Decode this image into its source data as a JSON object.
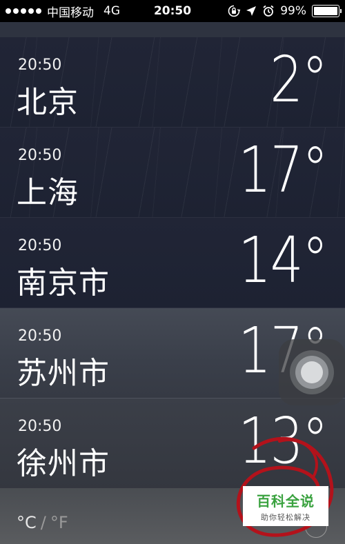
{
  "status": {
    "carrier": "中国移动",
    "network": "4G",
    "time": "20:50",
    "battery": "99%",
    "battery_level": 0.99
  },
  "cities": [
    {
      "time": "20:50",
      "name": "北京",
      "temp": "2°"
    },
    {
      "time": "20:50",
      "name": "上海",
      "temp": "17°"
    },
    {
      "time": "20:50",
      "name": "南京市",
      "temp": "14°"
    },
    {
      "time": "20:50",
      "name": "苏州市",
      "temp": "17°"
    },
    {
      "time": "20:50",
      "name": "徐州市",
      "temp": "13°"
    }
  ],
  "units": {
    "celsius": "°C",
    "separator": "/",
    "fahrenheit": "°F"
  },
  "watermark": {
    "title": "百科全说",
    "subtitle": "助你轻松解决"
  },
  "colors": {
    "scribble": "#b3121b"
  }
}
